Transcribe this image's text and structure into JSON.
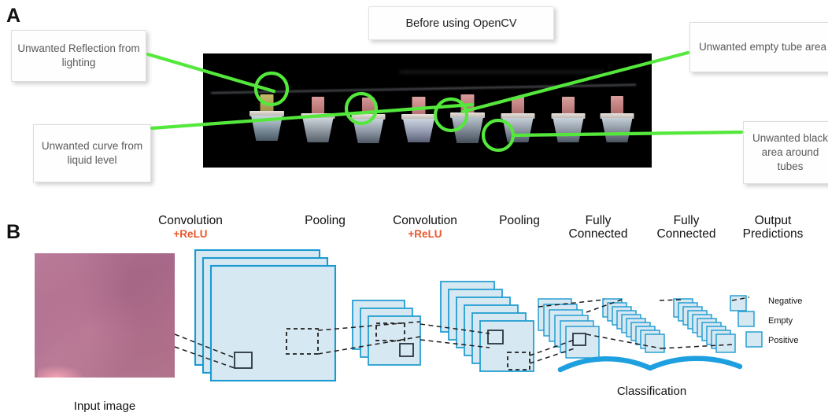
{
  "figure": {
    "panels": [
      {
        "letter": "A"
      },
      {
        "letter": "B"
      }
    ]
  },
  "panel_a": {
    "letter": "A",
    "title": "Before using OpenCV",
    "callouts": [
      {
        "id": "reflection",
        "text": "Unwanted Reflection from lighting"
      },
      {
        "id": "curve",
        "text": "Unwanted curve from liquid level"
      },
      {
        "id": "empty-tube",
        "text": "Unwanted empty tube area"
      },
      {
        "id": "black-area",
        "text": "Unwanted black area around tubes"
      }
    ],
    "photo": {
      "description": "Row of eight laboratory test tubes photographed against a black background",
      "tube_count": 8,
      "background_color": "#000000",
      "annotation_color": "#55e83c",
      "annotation_circle_count": 4
    }
  },
  "panel_b": {
    "letter": "B",
    "stages": [
      {
        "id": "convolution-1",
        "label": "Convolution",
        "sub": "+ReLU"
      },
      {
        "id": "pooling-1",
        "label": "Pooling",
        "sub": ""
      },
      {
        "id": "convolution-2",
        "label": "Convolution",
        "sub": "+ReLU"
      },
      {
        "id": "pooling-2",
        "label": "Pooling",
        "sub": ""
      },
      {
        "id": "fully-connected-1",
        "label": "Fully\nConnected",
        "sub": ""
      },
      {
        "id": "fully-connected-2",
        "label": "Fully\nConnected",
        "sub": ""
      },
      {
        "id": "output-predictions",
        "label": "Output\nPredictions",
        "sub": ""
      }
    ],
    "stage_labels": {
      "conv1": "Convolution",
      "conv1_sub": "+ReLU",
      "pool1": "Pooling",
      "conv2": "Convolution",
      "conv2_sub": "+ReLU",
      "pool2": "Pooling",
      "fc1_line1": "Fully",
      "fc1_line2": "Connected",
      "fc2_line1": "Fully",
      "fc2_line2": "Connected",
      "out_line1": "Output",
      "out_line2": "Predictions"
    },
    "input_image_caption": "Input image",
    "classification_caption": "Classification",
    "predictions": [
      {
        "label": "Negative"
      },
      {
        "label": "Empty"
      },
      {
        "label": "Positive"
      }
    ],
    "colors": {
      "feature_map_fill": "#d6e8f2",
      "feature_map_border": "#1a9ad0",
      "relu_text": "#e8562a",
      "classification_brace": "#1e9fe0",
      "kernel_outline": "#2b3440"
    }
  }
}
